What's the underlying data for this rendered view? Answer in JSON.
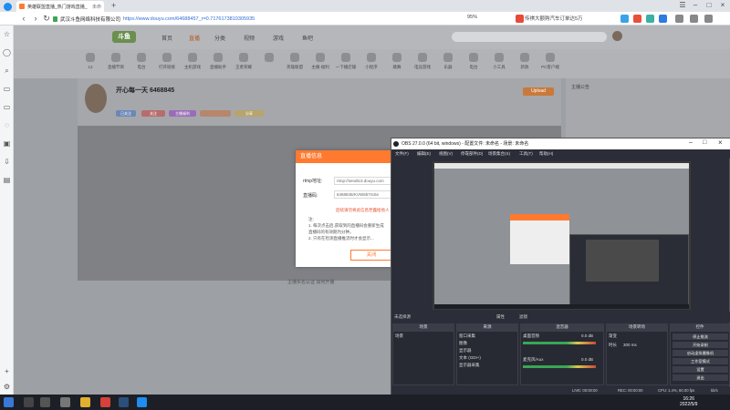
{
  "browser": {
    "tab_title": "英雄联盟直播_热门游戏直播_",
    "tab_suffix": "未命",
    "new_tab_symbol": "+",
    "url_host": "武汉斗鱼网络科技有限公司",
    "url_path": "https://www.douyu.com/64688457_r=0.7176173810305935",
    "zoom": "95%",
    "ad_text": "传祺大额购汽车订单达5万",
    "colors": {
      "tab_bg": "#ffffff",
      "accent_link": "#2f6bd3"
    }
  },
  "site": {
    "logo_text": "斗鱼",
    "nav": [
      "首页",
      "直播",
      "分类",
      "视频",
      "游戏",
      "鱼吧"
    ],
    "categories": [
      "12",
      "直播节目",
      "电台",
      "打开链接",
      "主机游戏",
      "直播助手",
      "王者荣耀",
      "",
      "英雄联盟",
      "主播-福利",
      "一下播店铺",
      "小程序",
      "跳舞",
      "电竞游戏",
      "乐器",
      "电台",
      "小工具",
      "新款",
      "PC客户端"
    ],
    "room_title": "开心每一天 6468845",
    "room_tags": [
      "已关注",
      "关注",
      "主播福利",
      "",
      "分享"
    ],
    "badge_orange": "Upload",
    "under_player": "主播实名认证  如何开播",
    "side_notice": "主播公告"
  },
  "modal": {
    "title": "直播信息",
    "label_rtmp": "rtmp地址:",
    "rtmp_value": "rtmp://sendtc3.douyu.com",
    "label_key": "直播码:",
    "key_value": "6468845rKVW657rsSe",
    "warn": "后续请勿将此信息泄露给他人",
    "notes": [
      "注:",
      "1. 每次点击后,获取到的直播码会重新生成",
      "直播码的有效期为分钟。",
      "2. 只有在检测直播推流时才会显示..."
    ],
    "ok_label": "关闭"
  },
  "obs": {
    "title": "OBS 27.0.0 (64 bit, windows) - 配置文件: 未命名 - 场景: 未命名",
    "menu": [
      "文件(F)",
      "编辑(E)",
      "视图(V)",
      "停靠部件(D)",
      "场景集合(S)",
      "工具(T)",
      "帮助(H)"
    ],
    "scene_bar": "未选择源",
    "scene_tabs": [
      "属性",
      "滤镜"
    ],
    "panels": {
      "scenes": {
        "title": "场景",
        "items": [
          "场景"
        ]
      },
      "sources": {
        "title": "来源",
        "items": [
          "窗口采集",
          "图像",
          "显示器",
          "文本 (GDI+)",
          "显示器采集"
        ]
      },
      "mixer": {
        "title": "混音器",
        "items": [
          "桌面音频",
          "麦克风/Aux"
        ],
        "db": [
          "0.0 dB",
          "0.0 dB"
        ]
      },
      "transitions": {
        "title": "场景转场",
        "fade": "渐变",
        "duration_label": "时长",
        "duration": "300 ms"
      },
      "controls": {
        "title": "控件",
        "buttons": [
          "停止推流",
          "开始录制",
          "启动虚拟摄像机",
          "工作室模式",
          "设置",
          "退出"
        ]
      }
    },
    "status": {
      "live": "LIVE: 00:00:00",
      "rec": "REC: 00:00:00",
      "cpu": "CPU: 1.4%, 60.00 fps",
      "kbps": "kb/s"
    }
  },
  "taskbar": {
    "time": "16:26",
    "date": "2022/5/9"
  }
}
